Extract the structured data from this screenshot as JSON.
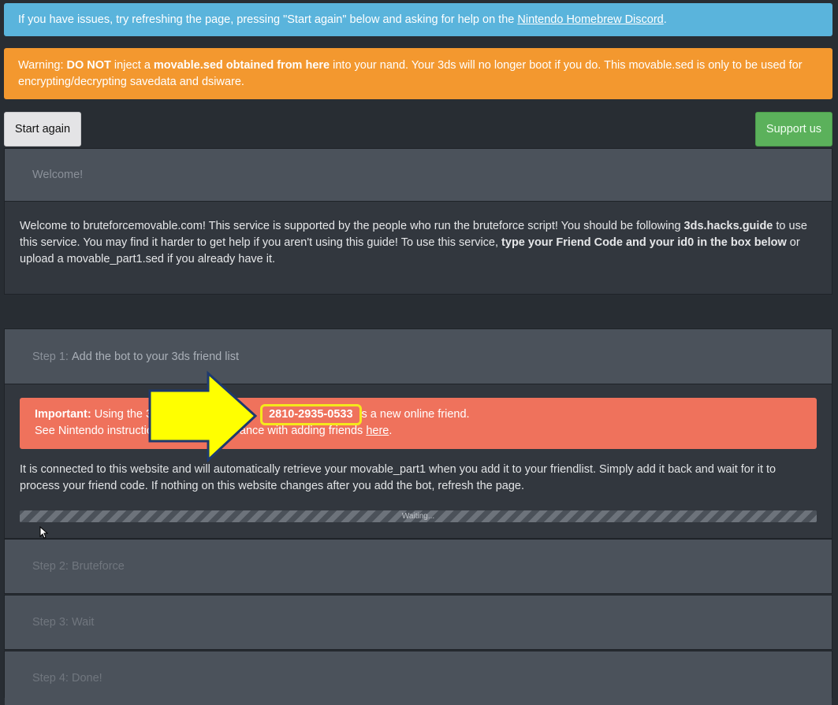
{
  "info_alert": {
    "text": "If you have issues, try refreshing the page, pressing \"Start again\" below and asking for help on the ",
    "link": "Nintendo Homebrew Discord",
    "end": "."
  },
  "warning_alert": {
    "prefix": "Warning: ",
    "do_not": "DO NOT",
    "text1": " inject a ",
    "bold": "movable.sed obtained from here",
    "text2": " into your nand. Your 3ds will no longer boot if you do. This movable.sed is only to be used for encrypting/decrypting savedata and dsiware."
  },
  "buttons": {
    "start_again": "Start again",
    "support_us": "Support us"
  },
  "welcome": {
    "header": "Welcome!",
    "text1": "Welcome to bruteforcemovable.com! This service is supported by the people who run the bruteforce script! You should be following ",
    "guide": "3ds.hacks.guide",
    "text2": " to use this service. You may find it harder to get help if you aren't using this guide! To use this service, ",
    "bold": "type your Friend Code and your id0 in the box below",
    "text3": " or upload a movable_part1.sed if you already have it."
  },
  "step1": {
    "header_prefix": "Step 1: ",
    "header_rest": "Add the bot to your 3ds friend list",
    "important_label": "Important:",
    "important_text1": " Using the 3",
    "friend_code": "2810-2935-0533",
    "important_text2": "s a new online friend.",
    "see_text": "See Nintendo instructio",
    "see_text2": "ance with adding friends ",
    "here_link": "here",
    "see_end": ".",
    "description": "It is connected to this website and will automatically retrieve your movable_part1 when you add it to your friendlist. Simply add it back and wait for it to process your friend code. If nothing on this website changes after you add the bot, refresh the page.",
    "progress_label": "Waiting..."
  },
  "step2": {
    "header": "Step 2: Bruteforce"
  },
  "step3": {
    "header": "Step 3: Wait"
  },
  "step4": {
    "header": "Step 4: Done!"
  },
  "colors": {
    "info": "#5ab4dc",
    "warning": "#f3982f",
    "danger": "#ef725c",
    "success": "#5bb15b",
    "highlight": "#f5e81c",
    "arrow_fill": "#ffff00"
  }
}
